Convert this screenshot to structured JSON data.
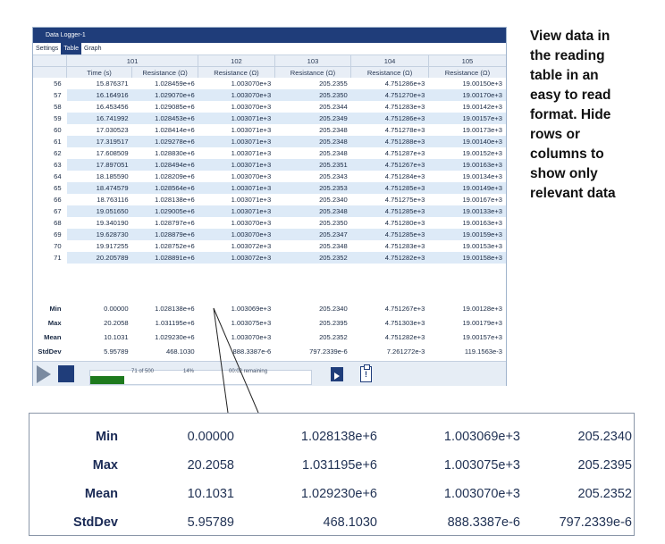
{
  "window": {
    "title": "Data Logger-1"
  },
  "tabs": [
    "Settings",
    "Table",
    "Graph"
  ],
  "table": {
    "channel_headers": [
      "101",
      "102",
      "103",
      "104",
      "105"
    ],
    "column_headers": [
      "Time (s)",
      "Resistance (Ω)",
      "Resistance (Ω)",
      "Resistance (Ω)",
      "Resistance (Ω)",
      "Resistance (Ω)"
    ],
    "rows": [
      [
        "56",
        "15.876371",
        "1.028459e+6",
        "1.003070e+3",
        "205.2355",
        "4.751286e+3",
        "19.00150e+3"
      ],
      [
        "57",
        "16.164916",
        "1.029070e+6",
        "1.003070e+3",
        "205.2350",
        "4.751270e+3",
        "19.00170e+3"
      ],
      [
        "58",
        "16.453456",
        "1.029085e+6",
        "1.003070e+3",
        "205.2344",
        "4.751283e+3",
        "19.00142e+3"
      ],
      [
        "59",
        "16.741992",
        "1.028453e+6",
        "1.003071e+3",
        "205.2349",
        "4.751286e+3",
        "19.00157e+3"
      ],
      [
        "60",
        "17.030523",
        "1.028414e+6",
        "1.003071e+3",
        "205.2348",
        "4.751278e+3",
        "19.00173e+3"
      ],
      [
        "61",
        "17.319517",
        "1.029278e+6",
        "1.003071e+3",
        "205.2348",
        "4.751288e+3",
        "19.00140e+3"
      ],
      [
        "62",
        "17.608509",
        "1.028830e+6",
        "1.003071e+3",
        "205.2348",
        "4.751287e+3",
        "19.00152e+3"
      ],
      [
        "63",
        "17.897051",
        "1.028494e+6",
        "1.003071e+3",
        "205.2351",
        "4.751267e+3",
        "19.00163e+3"
      ],
      [
        "64",
        "18.185590",
        "1.028209e+6",
        "1.003070e+3",
        "205.2343",
        "4.751284e+3",
        "19.00134e+3"
      ],
      [
        "65",
        "18.474579",
        "1.028564e+6",
        "1.003071e+3",
        "205.2353",
        "4.751285e+3",
        "19.00149e+3"
      ],
      [
        "66",
        "18.763116",
        "1.028138e+6",
        "1.003071e+3",
        "205.2340",
        "4.751275e+3",
        "19.00167e+3"
      ],
      [
        "67",
        "19.051650",
        "1.029005e+6",
        "1.003071e+3",
        "205.2348",
        "4.751285e+3",
        "19.00133e+3"
      ],
      [
        "68",
        "19.340190",
        "1.028797e+6",
        "1.003070e+3",
        "205.2350",
        "4.751280e+3",
        "19.00163e+3"
      ],
      [
        "69",
        "19.628730",
        "1.028879e+6",
        "1.003070e+3",
        "205.2347",
        "4.751285e+3",
        "19.00159e+3"
      ],
      [
        "70",
        "19.917255",
        "1.028752e+6",
        "1.003072e+3",
        "205.2348",
        "4.751283e+3",
        "19.00153e+3"
      ],
      [
        "71",
        "20.205789",
        "1.028891e+6",
        "1.003072e+3",
        "205.2352",
        "4.751282e+3",
        "19.00158e+3"
      ]
    ],
    "stats": [
      [
        "Min",
        "0.00000",
        "1.028138e+6",
        "1.003069e+3",
        "205.2340",
        "4.751267e+3",
        "19.00128e+3"
      ],
      [
        "Max",
        "20.2058",
        "1.031195e+6",
        "1.003075e+3",
        "205.2395",
        "4.751303e+3",
        "19.00179e+3"
      ],
      [
        "Mean",
        "10.1031",
        "1.029230e+6",
        "1.003070e+3",
        "205.2352",
        "4.751282e+3",
        "19.00157e+3"
      ],
      [
        "StdDev",
        "5.95789",
        "468.1030",
        "888.3387e-6",
        "797.2339e-6",
        "7.261272e-3",
        "119.1563e-3"
      ]
    ]
  },
  "progress": {
    "count_text": "71 of 500",
    "percent_text": "14%",
    "remaining_text": "00:02 remaining",
    "fraction": 0.14
  },
  "description": "View data in\nthe reading\ntable in an\neasy to read\nformat. Hide\nrows or\ncolumns to\nshow only\nrelevant data",
  "zoom": {
    "rows": [
      [
        "Min",
        "0.00000",
        "1.028138e+6",
        "1.003069e+3",
        "205.2340"
      ],
      [
        "Max",
        "20.2058",
        "1.031195e+6",
        "1.003075e+3",
        "205.2395"
      ],
      [
        "Mean",
        "10.1031",
        "1.029230e+6",
        "1.003070e+3",
        "205.2352"
      ],
      [
        "StdDev",
        "5.95789",
        "468.1030",
        "888.3387e-6",
        "797.2339e-6"
      ]
    ]
  }
}
